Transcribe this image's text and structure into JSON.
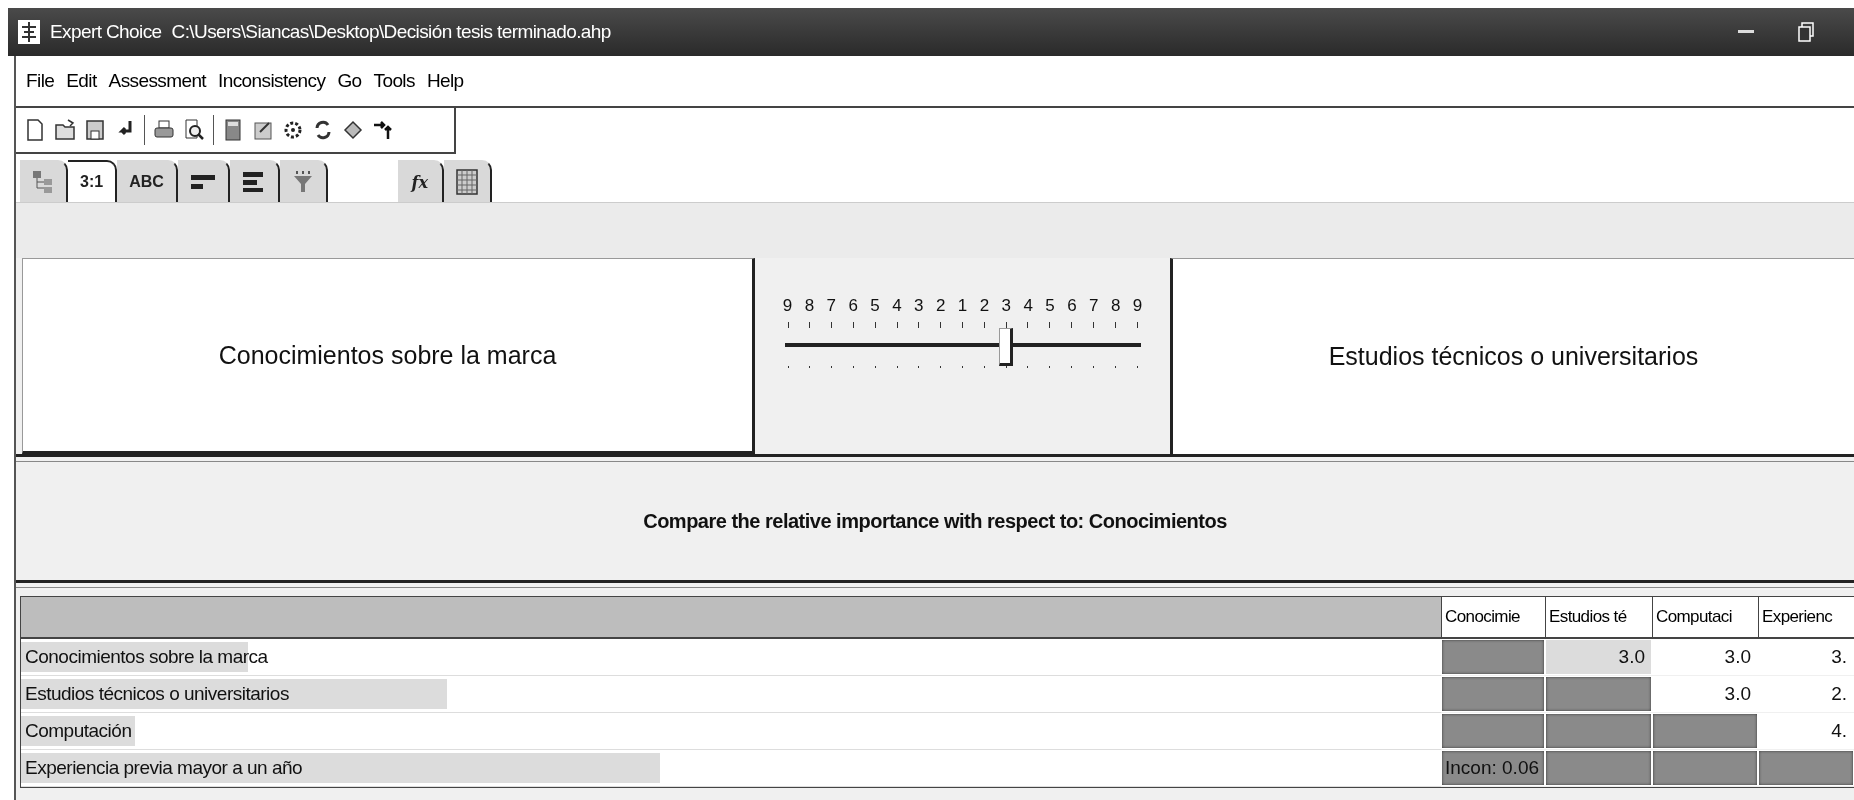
{
  "window": {
    "app": "Expert Choice",
    "path": "C:\\Users\\Siancas\\Desktop\\Decisión tesis terminado.ahp"
  },
  "menu": [
    "File",
    "Edit",
    "Assessment",
    "Inconsistency",
    "Go",
    "Tools",
    "Help"
  ],
  "tabs": [
    {
      "kind": "tree",
      "selected": false
    },
    {
      "kind": "text",
      "label": "3:1",
      "selected": true
    },
    {
      "kind": "text",
      "label": "ABC",
      "selected": false
    },
    {
      "kind": "bars",
      "selected": false
    },
    {
      "kind": "bars-right",
      "selected": false
    },
    {
      "kind": "funnel",
      "selected": false
    },
    {
      "kind": "formula",
      "label": "fx",
      "selected": false
    },
    {
      "kind": "grid",
      "selected": false
    }
  ],
  "comparison": {
    "left": "Conocimientos sobre la marca",
    "right": "Estudios técnicos o universitarios",
    "scale": [
      "9",
      "8",
      "7",
      "6",
      "5",
      "4",
      "3",
      "2",
      "1",
      "2",
      "3",
      "4",
      "5",
      "6",
      "7",
      "8",
      "9"
    ],
    "level": 0.625
  },
  "prompt": "Compare the relative importance with respect to: Conocimientos",
  "table": {
    "columns": [
      "Conocimie",
      "Estudios té",
      "Computaci",
      "Experienc"
    ],
    "rows": [
      {
        "label": "Conocimientos sobre la marca",
        "level": 0.16,
        "cells": [
          {
            "kind": "shaded"
          },
          {
            "kind": "value",
            "text": "3.0",
            "selected": true
          },
          {
            "kind": "value",
            "text": "3.0",
            "selected": false
          },
          {
            "kind": "value",
            "text": "3.",
            "selected": false
          }
        ]
      },
      {
        "label": "Estudios técnicos o universitarios",
        "level": 0.3,
        "cells": [
          {
            "kind": "shaded"
          },
          {
            "kind": "shaded"
          },
          {
            "kind": "value",
            "text": "3.0",
            "selected": false
          },
          {
            "kind": "value",
            "text": "2.",
            "selected": false
          }
        ]
      },
      {
        "label": "Computación",
        "level": 0.08,
        "cells": [
          {
            "kind": "shaded"
          },
          {
            "kind": "shaded"
          },
          {
            "kind": "shaded"
          },
          {
            "kind": "value",
            "text": "4.",
            "selected": false
          }
        ]
      },
      {
        "label": "Experiencia previa mayor a un año",
        "level": 0.45,
        "cells": [
          {
            "kind": "shaded",
            "text": "Incon: 0.06"
          },
          {
            "kind": "shaded"
          },
          {
            "kind": "shaded"
          },
          {
            "kind": "shaded"
          }
        ]
      }
    ]
  }
}
